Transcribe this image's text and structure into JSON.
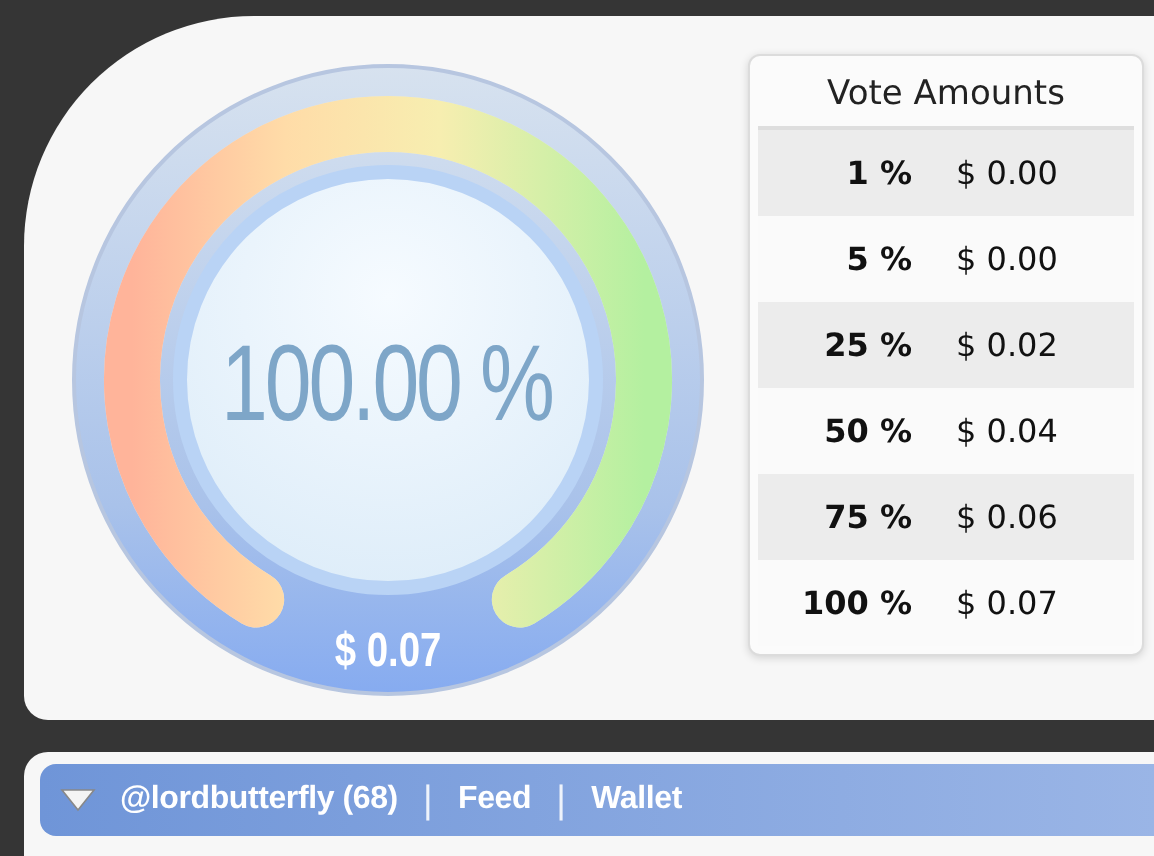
{
  "gauge": {
    "level": 1.0,
    "percent": "100.00 %",
    "value": "$ 0.07"
  },
  "vote_table": {
    "title": "Vote Amounts",
    "rows": [
      {
        "percent": "1 %",
        "amount": "$ 0.00"
      },
      {
        "percent": "5 %",
        "amount": "$ 0.00"
      },
      {
        "percent": "25 %",
        "amount": "$ 0.02"
      },
      {
        "percent": "50 %",
        "amount": "$ 0.04"
      },
      {
        "percent": "75 %",
        "amount": "$ 0.06"
      },
      {
        "percent": "100 %",
        "amount": "$ 0.07"
      }
    ]
  },
  "nav_bar": {
    "expanded": false,
    "items": [
      {
        "kind": "link",
        "text": "@lordbutterfly (68)"
      },
      {
        "kind": "separator",
        "text": "|"
      },
      {
        "kind": "link",
        "text": "Feed"
      },
      {
        "kind": "separator",
        "text": "|"
      },
      {
        "kind": "link",
        "text": "Wallet"
      }
    ]
  }
}
